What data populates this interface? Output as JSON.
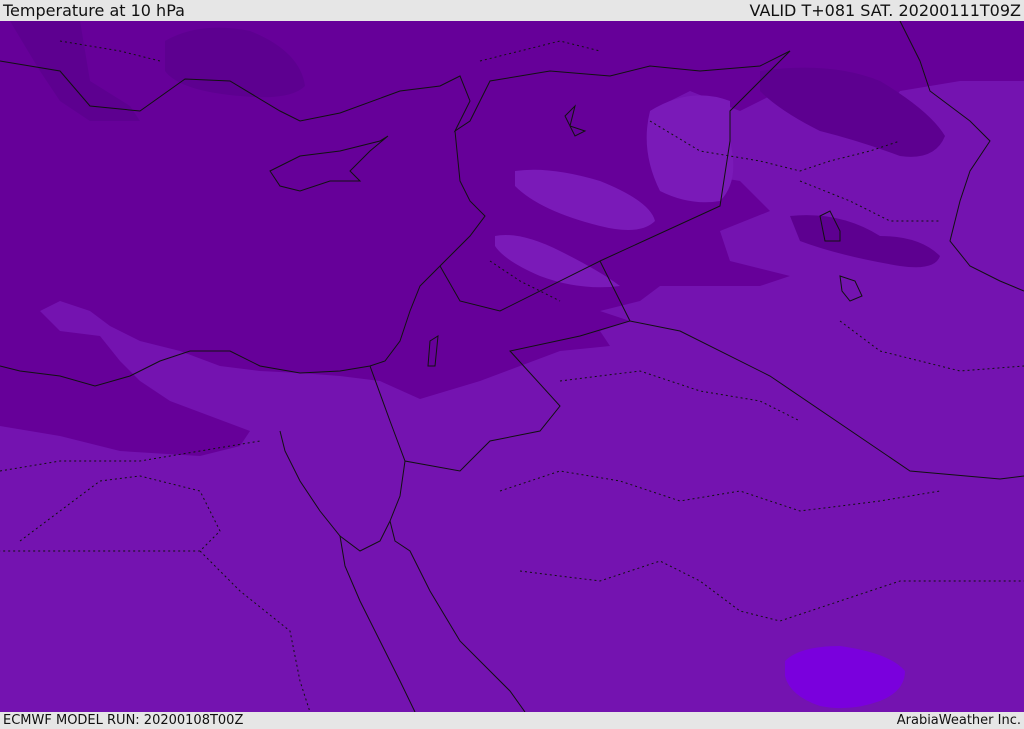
{
  "header": {
    "title": "Temperature at 10 hPa",
    "valid": "VALID T+081 SAT. 20200111T09Z"
  },
  "footer": {
    "model_run": "ECMWF MODEL RUN: 20200108T00Z",
    "credit": "ArabiaWeather Inc."
  },
  "colors": {
    "base": "#7413b0",
    "cold": "#660099",
    "coldest": "#5d0090",
    "warm": "#7a1ab8",
    "warmest": "#7a00dd",
    "border": "#111111"
  }
}
